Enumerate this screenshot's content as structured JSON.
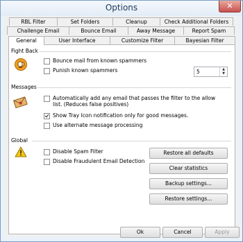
{
  "window": {
    "title": "Options",
    "close_glyph": "✕"
  },
  "tabs": {
    "row1": [
      "RBL Filter",
      "Set Folders",
      "Cleanup",
      "Check Additional Folders"
    ],
    "row2": [
      "Challenge Email",
      "Bounce Email",
      "Away Message",
      "Report Spam"
    ],
    "row3": [
      "General",
      "User Interface",
      "Customize Filter",
      "Bayesian Filter"
    ],
    "active": "General"
  },
  "fight_back": {
    "label": "Fight Back",
    "icon": "boxing-glove-icon",
    "bounce_label": "Bounce mail from known spammers",
    "bounce_checked": false,
    "punish_label": "Punish known spammers",
    "punish_checked": false,
    "punish_value": "5"
  },
  "messages": {
    "label": "Messages",
    "icon": "envelope-icon",
    "auto_add_label": "Automatically add any email that passes the filter to the allow list. (Reduces false positives)",
    "auto_add_checked": false,
    "tray_label": "Show Tray Icon notification only for good messages.",
    "tray_checked": true,
    "alternate_label": "Use alternate message processing",
    "alternate_checked": false
  },
  "global": {
    "label": "Global",
    "icon": "warning-icon",
    "disable_spam_label": "Disable Spam Filter",
    "disable_spam_checked": false,
    "disable_fraud_label": "Disable Fraudulent Email Detection",
    "disable_fraud_checked": false,
    "restore_defaults": "Restore all defaults",
    "clear_stats": "Clear statistics",
    "backup": "Backup settings...",
    "restore": "Restore settings..."
  },
  "footer": {
    "ok": "Ok",
    "cancel": "Cancel",
    "apply": "Apply"
  }
}
